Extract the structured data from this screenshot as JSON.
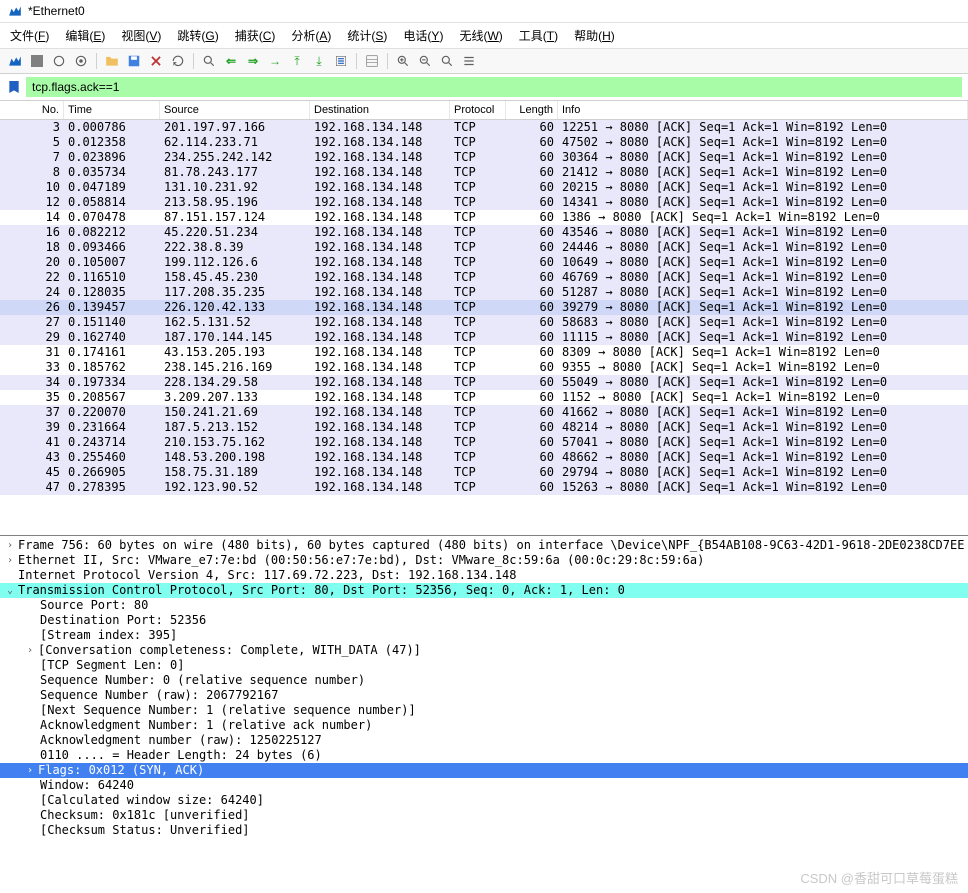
{
  "title": "*Ethernet0",
  "menu": [
    "文件(F)",
    "编辑(E)",
    "视图(V)",
    "跳转(G)",
    "捕获(C)",
    "分析(A)",
    "统计(S)",
    "电话(Y)",
    "无线(W)",
    "工具(T)",
    "帮助(H)"
  ],
  "filter": "tcp.flags.ack==1",
  "columns": [
    "No.",
    "Time",
    "Source",
    "Destination",
    "Protocol",
    "Length",
    "Info"
  ],
  "packets": [
    {
      "no": 3,
      "time": "0.000786",
      "src": "201.197.97.166",
      "dst": "192.168.134.148",
      "proto": "TCP",
      "len": 60,
      "info": "12251 → 8080 [ACK] Seq=1 Ack=1 Win=8192 Len=0",
      "alt": true
    },
    {
      "no": 5,
      "time": "0.012358",
      "src": "62.114.233.71",
      "dst": "192.168.134.148",
      "proto": "TCP",
      "len": 60,
      "info": "47502 → 8080 [ACK] Seq=1 Ack=1 Win=8192 Len=0",
      "alt": true
    },
    {
      "no": 7,
      "time": "0.023896",
      "src": "234.255.242.142",
      "dst": "192.168.134.148",
      "proto": "TCP",
      "len": 60,
      "info": "30364 → 8080 [ACK] Seq=1 Ack=1 Win=8192 Len=0",
      "alt": true
    },
    {
      "no": 8,
      "time": "0.035734",
      "src": "81.78.243.177",
      "dst": "192.168.134.148",
      "proto": "TCP",
      "len": 60,
      "info": "21412 → 8080 [ACK] Seq=1 Ack=1 Win=8192 Len=0",
      "alt": true
    },
    {
      "no": 10,
      "time": "0.047189",
      "src": "131.10.231.92",
      "dst": "192.168.134.148",
      "proto": "TCP",
      "len": 60,
      "info": "20215 → 8080 [ACK] Seq=1 Ack=1 Win=8192 Len=0",
      "alt": true
    },
    {
      "no": 12,
      "time": "0.058814",
      "src": "213.58.95.196",
      "dst": "192.168.134.148",
      "proto": "TCP",
      "len": 60,
      "info": "14341 → 8080 [ACK] Seq=1 Ack=1 Win=8192 Len=0",
      "alt": true
    },
    {
      "no": 14,
      "time": "0.070478",
      "src": "87.151.157.124",
      "dst": "192.168.134.148",
      "proto": "TCP",
      "len": 60,
      "info": "1386 → 8080 [ACK] Seq=1 Ack=1 Win=8192 Len=0",
      "alt": false
    },
    {
      "no": 16,
      "time": "0.082212",
      "src": "45.220.51.234",
      "dst": "192.168.134.148",
      "proto": "TCP",
      "len": 60,
      "info": "43546 → 8080 [ACK] Seq=1 Ack=1 Win=8192 Len=0",
      "alt": true
    },
    {
      "no": 18,
      "time": "0.093466",
      "src": "222.38.8.39",
      "dst": "192.168.134.148",
      "proto": "TCP",
      "len": 60,
      "info": "24446 → 8080 [ACK] Seq=1 Ack=1 Win=8192 Len=0",
      "alt": true
    },
    {
      "no": 20,
      "time": "0.105007",
      "src": "199.112.126.6",
      "dst": "192.168.134.148",
      "proto": "TCP",
      "len": 60,
      "info": "10649 → 8080 [ACK] Seq=1 Ack=1 Win=8192 Len=0",
      "alt": true
    },
    {
      "no": 22,
      "time": "0.116510",
      "src": "158.45.45.230",
      "dst": "192.168.134.148",
      "proto": "TCP",
      "len": 60,
      "info": "46769 → 8080 [ACK] Seq=1 Ack=1 Win=8192 Len=0",
      "alt": true
    },
    {
      "no": 24,
      "time": "0.128035",
      "src": "117.208.35.235",
      "dst": "192.168.134.148",
      "proto": "TCP",
      "len": 60,
      "info": "51287 → 8080 [ACK] Seq=1 Ack=1 Win=8192 Len=0",
      "alt": true
    },
    {
      "no": 26,
      "time": "0.139457",
      "src": "226.120.42.133",
      "dst": "192.168.134.148",
      "proto": "TCP",
      "len": 60,
      "info": "39279 → 8080 [ACK] Seq=1 Ack=1 Win=8192 Len=0",
      "sel": true
    },
    {
      "no": 27,
      "time": "0.151140",
      "src": "162.5.131.52",
      "dst": "192.168.134.148",
      "proto": "TCP",
      "len": 60,
      "info": "58683 → 8080 [ACK] Seq=1 Ack=1 Win=8192 Len=0",
      "alt": true
    },
    {
      "no": 29,
      "time": "0.162740",
      "src": "187.170.144.145",
      "dst": "192.168.134.148",
      "proto": "TCP",
      "len": 60,
      "info": "11115 → 8080 [ACK] Seq=1 Ack=1 Win=8192 Len=0",
      "alt": true
    },
    {
      "no": 31,
      "time": "0.174161",
      "src": "43.153.205.193",
      "dst": "192.168.134.148",
      "proto": "TCP",
      "len": 60,
      "info": "8309 → 8080 [ACK] Seq=1 Ack=1 Win=8192 Len=0",
      "alt": false
    },
    {
      "no": 33,
      "time": "0.185762",
      "src": "238.145.216.169",
      "dst": "192.168.134.148",
      "proto": "TCP",
      "len": 60,
      "info": "9355 → 8080 [ACK] Seq=1 Ack=1 Win=8192 Len=0",
      "alt": false
    },
    {
      "no": 34,
      "time": "0.197334",
      "src": "228.134.29.58",
      "dst": "192.168.134.148",
      "proto": "TCP",
      "len": 60,
      "info": "55049 → 8080 [ACK] Seq=1 Ack=1 Win=8192 Len=0",
      "alt": true
    },
    {
      "no": 35,
      "time": "0.208567",
      "src": "3.209.207.133",
      "dst": "192.168.134.148",
      "proto": "TCP",
      "len": 60,
      "info": "1152 → 8080 [ACK] Seq=1 Ack=1 Win=8192 Len=0",
      "alt": false
    },
    {
      "no": 37,
      "time": "0.220070",
      "src": "150.241.21.69",
      "dst": "192.168.134.148",
      "proto": "TCP",
      "len": 60,
      "info": "41662 → 8080 [ACK] Seq=1 Ack=1 Win=8192 Len=0",
      "alt": true
    },
    {
      "no": 39,
      "time": "0.231664",
      "src": "187.5.213.152",
      "dst": "192.168.134.148",
      "proto": "TCP",
      "len": 60,
      "info": "48214 → 8080 [ACK] Seq=1 Ack=1 Win=8192 Len=0",
      "alt": true
    },
    {
      "no": 41,
      "time": "0.243714",
      "src": "210.153.75.162",
      "dst": "192.168.134.148",
      "proto": "TCP",
      "len": 60,
      "info": "57041 → 8080 [ACK] Seq=1 Ack=1 Win=8192 Len=0",
      "alt": true
    },
    {
      "no": 43,
      "time": "0.255460",
      "src": "148.53.200.198",
      "dst": "192.168.134.148",
      "proto": "TCP",
      "len": 60,
      "info": "48662 → 8080 [ACK] Seq=1 Ack=1 Win=8192 Len=0",
      "alt": true
    },
    {
      "no": 45,
      "time": "0.266905",
      "src": "158.75.31.189",
      "dst": "192.168.134.148",
      "proto": "TCP",
      "len": 60,
      "info": "29794 → 8080 [ACK] Seq=1 Ack=1 Win=8192 Len=0",
      "alt": true
    },
    {
      "no": 47,
      "time": "0.278395",
      "src": "192.123.90.52",
      "dst": "192.168.134.148",
      "proto": "TCP",
      "len": 60,
      "info": "15263 → 8080 [ACK] Seq=1 Ack=1 Win=8192 Len=0",
      "alt": true
    }
  ],
  "details": {
    "frame": "Frame 756: 60 bytes on wire (480 bits), 60 bytes captured (480 bits) on interface \\Device\\NPF_{B54AB108-9C63-42D1-9618-2DE0238CD7EE",
    "eth": "Ethernet II, Src: VMware_e7:7e:bd (00:50:56:e7:7e:bd), Dst: VMware_8c:59:6a (00:0c:29:8c:59:6a)",
    "ip": "Internet Protocol Version 4, Src: 117.69.72.223, Dst: 192.168.134.148",
    "tcp": "Transmission Control Protocol, Src Port: 80, Dst Port: 52356, Seq: 0, Ack: 1, Len: 0",
    "srcport": "Source Port: 80",
    "dstport": "Destination Port: 52356",
    "stream": "[Stream index: 395]",
    "conv": "[Conversation completeness: Complete, WITH_DATA (47)]",
    "seglen": "[TCP Segment Len: 0]",
    "seqnum": "Sequence Number: 0    (relative sequence number)",
    "seqraw": "Sequence Number (raw): 2067792167",
    "nextseq": "[Next Sequence Number: 1    (relative sequence number)]",
    "acknum": "Acknowledgment Number: 1    (relative ack number)",
    "ackraw": "Acknowledgment number (raw): 1250225127",
    "hdrlen": "0110 .... = Header Length: 24 bytes (6)",
    "flags": "Flags: 0x012 (SYN, ACK)",
    "window": "Window: 64240",
    "calcwin": "[Calculated window size: 64240]",
    "cksum": "Checksum: 0x181c [unverified]",
    "ckstat": "[Checksum Status: Unverified]"
  },
  "watermark": "CSDN @香甜可口草莓蛋糕"
}
